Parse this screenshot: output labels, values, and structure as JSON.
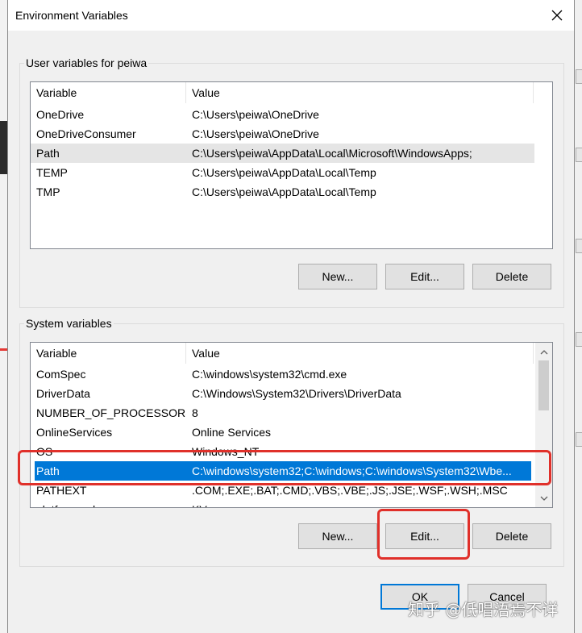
{
  "dialog": {
    "title": "Environment Variables",
    "close_icon": "close-icon"
  },
  "user_vars": {
    "label": "User variables for peiwa",
    "columns": [
      "Variable",
      "Value"
    ],
    "rows": [
      {
        "name": "OneDrive",
        "value": "C:\\Users\\peiwa\\OneDrive"
      },
      {
        "name": "OneDriveConsumer",
        "value": "C:\\Users\\peiwa\\OneDrive"
      },
      {
        "name": "Path",
        "value": "C:\\Users\\peiwa\\AppData\\Local\\Microsoft\\WindowsApps;"
      },
      {
        "name": "TEMP",
        "value": "C:\\Users\\peiwa\\AppData\\Local\\Temp"
      },
      {
        "name": "TMP",
        "value": "C:\\Users\\peiwa\\AppData\\Local\\Temp"
      }
    ],
    "buttons": {
      "new": "New...",
      "edit": "Edit...",
      "delete": "Delete"
    }
  },
  "system_vars": {
    "label": "System variables",
    "columns": [
      "Variable",
      "Value"
    ],
    "rows": [
      {
        "name": "ComSpec",
        "value": "C:\\windows\\system32\\cmd.exe"
      },
      {
        "name": "DriverData",
        "value": "C:\\Windows\\System32\\Drivers\\DriverData"
      },
      {
        "name": "NUMBER_OF_PROCESSORS",
        "value": "8"
      },
      {
        "name": "OnlineServices",
        "value": "Online Services"
      },
      {
        "name": "OS",
        "value": "Windows_NT"
      },
      {
        "name": "Path",
        "value": "C:\\windows\\system32;C:\\windows;C:\\windows\\System32\\Wbe..."
      },
      {
        "name": "PATHEXT",
        "value": ".COM;.EXE;.BAT;.CMD;.VBS;.VBE;.JS;.JSE;.WSF;.WSH;.MSC"
      },
      {
        "name": "platformcode",
        "value": "KV"
      }
    ],
    "buttons": {
      "new": "New...",
      "edit": "Edit...",
      "delete": "Delete"
    }
  },
  "footer": {
    "ok": "OK",
    "cancel": "Cancel"
  },
  "watermark": "知乎 @低唱浯焉不详",
  "colors": {
    "selection": "#0078d7",
    "highlight": "#e0302a",
    "dialog_bg": "#f0f0f0"
  }
}
